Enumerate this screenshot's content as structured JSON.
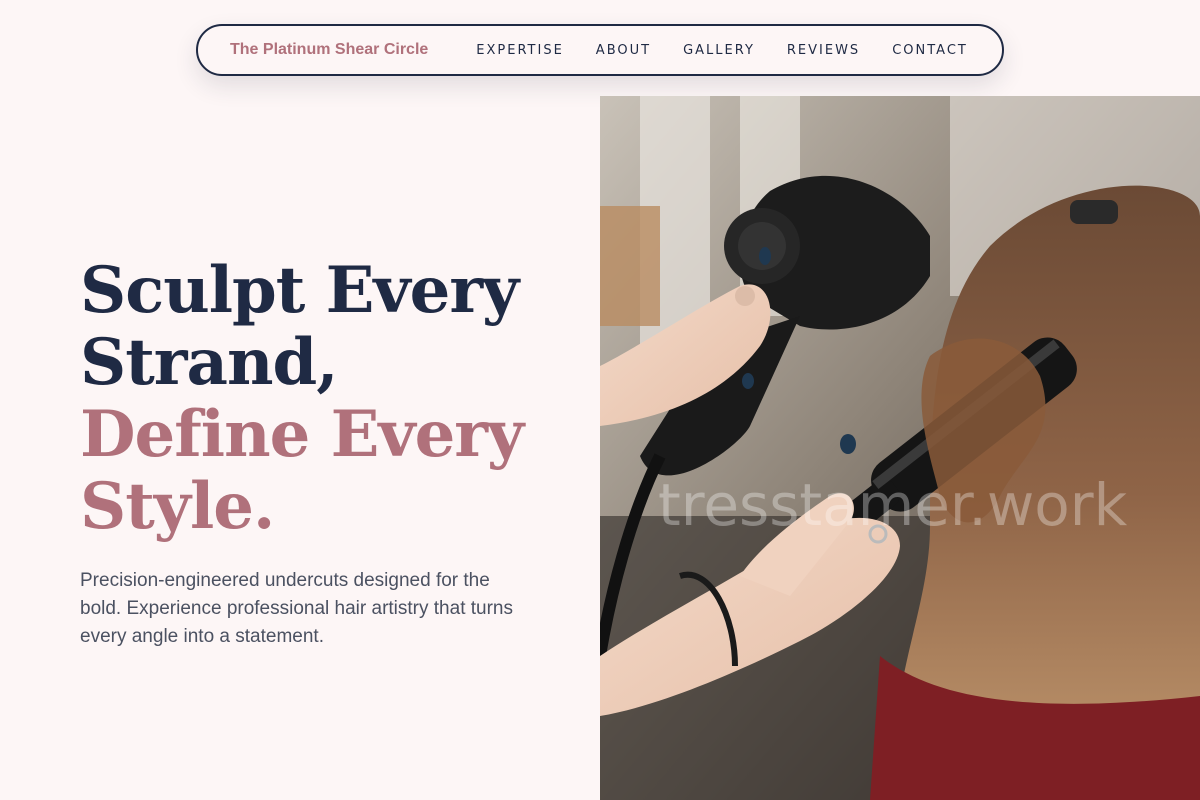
{
  "nav": {
    "brand": "The Platinum Shear Circle",
    "links": [
      "EXPERTISE",
      "ABOUT",
      "GALLERY",
      "REVIEWS",
      "CONTACT"
    ]
  },
  "hero": {
    "headline_dark_1": "Sculpt Every",
    "headline_dark_2": "Strand,",
    "headline_rose_1": "Define Every",
    "headline_rose_2": "Style.",
    "subtext": "Precision-engineered undercuts designed for the bold. Experience professional hair artistry that turns every angle into a statement.",
    "image_watermark": "tresstamer.work"
  },
  "colors": {
    "navy": "#1f2a44",
    "rose": "#b0717b",
    "background": "#fdf6f6",
    "body_text": "#4b5161"
  }
}
